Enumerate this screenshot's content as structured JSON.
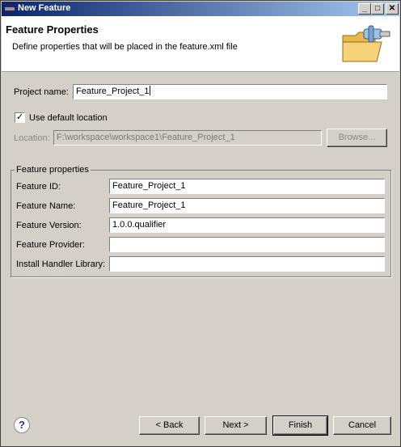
{
  "window": {
    "title": "New Feature",
    "icon": "eclipse-icon"
  },
  "titlebar_buttons": {
    "minimize": "_",
    "maximize": "□",
    "close": "✕"
  },
  "header": {
    "title": "Feature Properties",
    "description": "Define properties that will be placed in the feature.xml file",
    "icon": "folder-plugin-icon"
  },
  "project": {
    "label": "Project name:",
    "value": "Feature_Project_1"
  },
  "default_location": {
    "label": "Use default location",
    "checked": true,
    "check_glyph": "✓"
  },
  "location": {
    "label": "Location:",
    "value": "F:\\workspace\\workspace1\\Feature_Project_1",
    "browse_label": "Browse..."
  },
  "feature_properties": {
    "group_label": "Feature properties",
    "fields": [
      {
        "label": "Feature ID:",
        "value": "Feature_Project_1"
      },
      {
        "label": "Feature Name:",
        "value": "Feature_Project_1"
      },
      {
        "label": "Feature Version:",
        "value": "1.0.0.qualifier"
      },
      {
        "label": "Feature Provider:",
        "value": ""
      },
      {
        "label": "Install Handler Library:",
        "value": ""
      }
    ]
  },
  "buttons": {
    "help": "?",
    "back": "< Back",
    "next": "Next >",
    "finish": "Finish",
    "cancel": "Cancel"
  }
}
